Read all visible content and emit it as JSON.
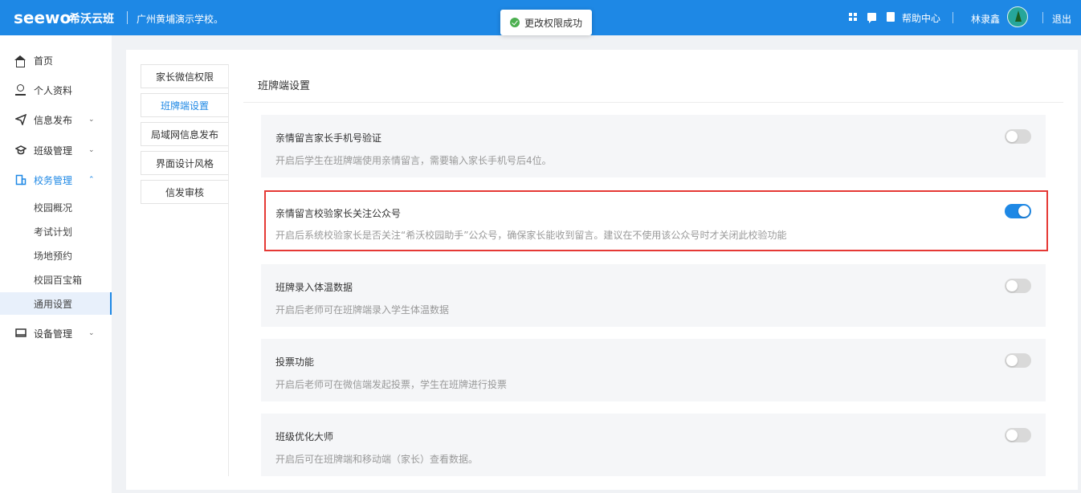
{
  "header": {
    "logo": "seewo",
    "product": "希沃云班",
    "school": "广州黄埔演示学校。",
    "help": "帮助中心",
    "user": "林隶鑫",
    "logout": "退出",
    "color": "#1e88e5"
  },
  "toast": {
    "text": "更改权限成功",
    "icon": "check-circle-icon"
  },
  "sidebar": {
    "items": [
      {
        "label": "首页",
        "icon": "home-icon"
      },
      {
        "label": "个人资料",
        "icon": "user-icon"
      },
      {
        "label": "信息发布",
        "icon": "send-icon"
      },
      {
        "label": "班级管理",
        "icon": "graduation-cap-icon"
      },
      {
        "label": "校务管理",
        "icon": "school-icon"
      },
      {
        "label": "设备管理",
        "icon": "device-icon"
      }
    ],
    "sub_items": [
      "校园概况",
      "考试计划",
      "场地预约",
      "校园百宝箱",
      "通用设置"
    ]
  },
  "tabs": [
    "家长微信权限",
    "班牌端设置",
    "局域网信息发布",
    "界面设计风格",
    "信发审核"
  ],
  "section_title": "班牌端设置",
  "settings": [
    {
      "title": "亲情留言家长手机号验证",
      "desc": "开启后学生在班牌端使用亲情留言，需要输入家长手机号后4位。",
      "enabled": false
    },
    {
      "title": "亲情留言校验家长关注公众号",
      "desc": "开启后系统校验家长是否关注“希沃校园助手”公众号，确保家长能收到留言。建议在不使用该公众号时才关闭此校验功能",
      "enabled": true
    },
    {
      "title": "班牌录入体温数据",
      "desc": "开启后老师可在班牌端录入学生体温数据",
      "enabled": false
    },
    {
      "title": "投票功能",
      "desc": "开启后老师可在微信端发起投票，学生在班牌进行投票",
      "enabled": false
    },
    {
      "title": "班级优化大师",
      "desc": "开启后可在班牌端和移动端（家长）查看数据。",
      "enabled": false
    }
  ]
}
